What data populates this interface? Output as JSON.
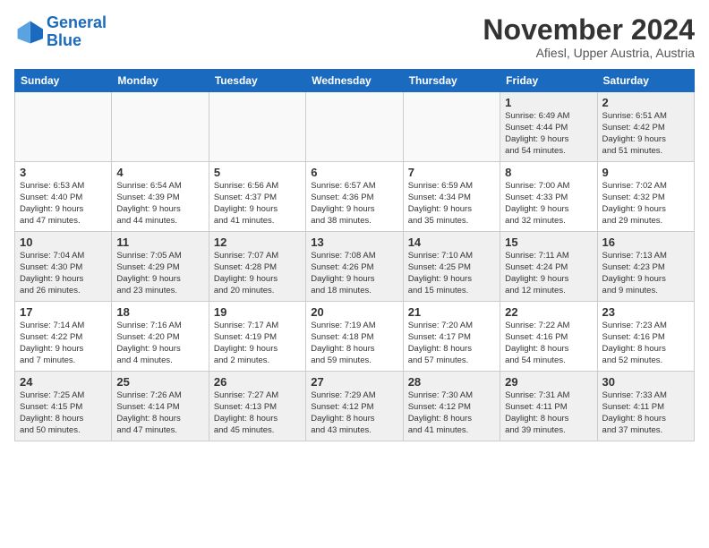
{
  "logo": {
    "line1": "General",
    "line2": "Blue"
  },
  "title": "November 2024",
  "location": "Afiesl, Upper Austria, Austria",
  "days_header": [
    "Sunday",
    "Monday",
    "Tuesday",
    "Wednesday",
    "Thursday",
    "Friday",
    "Saturday"
  ],
  "weeks": [
    [
      {
        "day": "",
        "info": ""
      },
      {
        "day": "",
        "info": ""
      },
      {
        "day": "",
        "info": ""
      },
      {
        "day": "",
        "info": ""
      },
      {
        "day": "",
        "info": ""
      },
      {
        "day": "1",
        "info": "Sunrise: 6:49 AM\nSunset: 4:44 PM\nDaylight: 9 hours\nand 54 minutes."
      },
      {
        "day": "2",
        "info": "Sunrise: 6:51 AM\nSunset: 4:42 PM\nDaylight: 9 hours\nand 51 minutes."
      }
    ],
    [
      {
        "day": "3",
        "info": "Sunrise: 6:53 AM\nSunset: 4:40 PM\nDaylight: 9 hours\nand 47 minutes."
      },
      {
        "day": "4",
        "info": "Sunrise: 6:54 AM\nSunset: 4:39 PM\nDaylight: 9 hours\nand 44 minutes."
      },
      {
        "day": "5",
        "info": "Sunrise: 6:56 AM\nSunset: 4:37 PM\nDaylight: 9 hours\nand 41 minutes."
      },
      {
        "day": "6",
        "info": "Sunrise: 6:57 AM\nSunset: 4:36 PM\nDaylight: 9 hours\nand 38 minutes."
      },
      {
        "day": "7",
        "info": "Sunrise: 6:59 AM\nSunset: 4:34 PM\nDaylight: 9 hours\nand 35 minutes."
      },
      {
        "day": "8",
        "info": "Sunrise: 7:00 AM\nSunset: 4:33 PM\nDaylight: 9 hours\nand 32 minutes."
      },
      {
        "day": "9",
        "info": "Sunrise: 7:02 AM\nSunset: 4:32 PM\nDaylight: 9 hours\nand 29 minutes."
      }
    ],
    [
      {
        "day": "10",
        "info": "Sunrise: 7:04 AM\nSunset: 4:30 PM\nDaylight: 9 hours\nand 26 minutes."
      },
      {
        "day": "11",
        "info": "Sunrise: 7:05 AM\nSunset: 4:29 PM\nDaylight: 9 hours\nand 23 minutes."
      },
      {
        "day": "12",
        "info": "Sunrise: 7:07 AM\nSunset: 4:28 PM\nDaylight: 9 hours\nand 20 minutes."
      },
      {
        "day": "13",
        "info": "Sunrise: 7:08 AM\nSunset: 4:26 PM\nDaylight: 9 hours\nand 18 minutes."
      },
      {
        "day": "14",
        "info": "Sunrise: 7:10 AM\nSunset: 4:25 PM\nDaylight: 9 hours\nand 15 minutes."
      },
      {
        "day": "15",
        "info": "Sunrise: 7:11 AM\nSunset: 4:24 PM\nDaylight: 9 hours\nand 12 minutes."
      },
      {
        "day": "16",
        "info": "Sunrise: 7:13 AM\nSunset: 4:23 PM\nDaylight: 9 hours\nand 9 minutes."
      }
    ],
    [
      {
        "day": "17",
        "info": "Sunrise: 7:14 AM\nSunset: 4:22 PM\nDaylight: 9 hours\nand 7 minutes."
      },
      {
        "day": "18",
        "info": "Sunrise: 7:16 AM\nSunset: 4:20 PM\nDaylight: 9 hours\nand 4 minutes."
      },
      {
        "day": "19",
        "info": "Sunrise: 7:17 AM\nSunset: 4:19 PM\nDaylight: 9 hours\nand 2 minutes."
      },
      {
        "day": "20",
        "info": "Sunrise: 7:19 AM\nSunset: 4:18 PM\nDaylight: 8 hours\nand 59 minutes."
      },
      {
        "day": "21",
        "info": "Sunrise: 7:20 AM\nSunset: 4:17 PM\nDaylight: 8 hours\nand 57 minutes."
      },
      {
        "day": "22",
        "info": "Sunrise: 7:22 AM\nSunset: 4:16 PM\nDaylight: 8 hours\nand 54 minutes."
      },
      {
        "day": "23",
        "info": "Sunrise: 7:23 AM\nSunset: 4:16 PM\nDaylight: 8 hours\nand 52 minutes."
      }
    ],
    [
      {
        "day": "24",
        "info": "Sunrise: 7:25 AM\nSunset: 4:15 PM\nDaylight: 8 hours\nand 50 minutes."
      },
      {
        "day": "25",
        "info": "Sunrise: 7:26 AM\nSunset: 4:14 PM\nDaylight: 8 hours\nand 47 minutes."
      },
      {
        "day": "26",
        "info": "Sunrise: 7:27 AM\nSunset: 4:13 PM\nDaylight: 8 hours\nand 45 minutes."
      },
      {
        "day": "27",
        "info": "Sunrise: 7:29 AM\nSunset: 4:12 PM\nDaylight: 8 hours\nand 43 minutes."
      },
      {
        "day": "28",
        "info": "Sunrise: 7:30 AM\nSunset: 4:12 PM\nDaylight: 8 hours\nand 41 minutes."
      },
      {
        "day": "29",
        "info": "Sunrise: 7:31 AM\nSunset: 4:11 PM\nDaylight: 8 hours\nand 39 minutes."
      },
      {
        "day": "30",
        "info": "Sunrise: 7:33 AM\nSunset: 4:11 PM\nDaylight: 8 hours\nand 37 minutes."
      }
    ]
  ]
}
